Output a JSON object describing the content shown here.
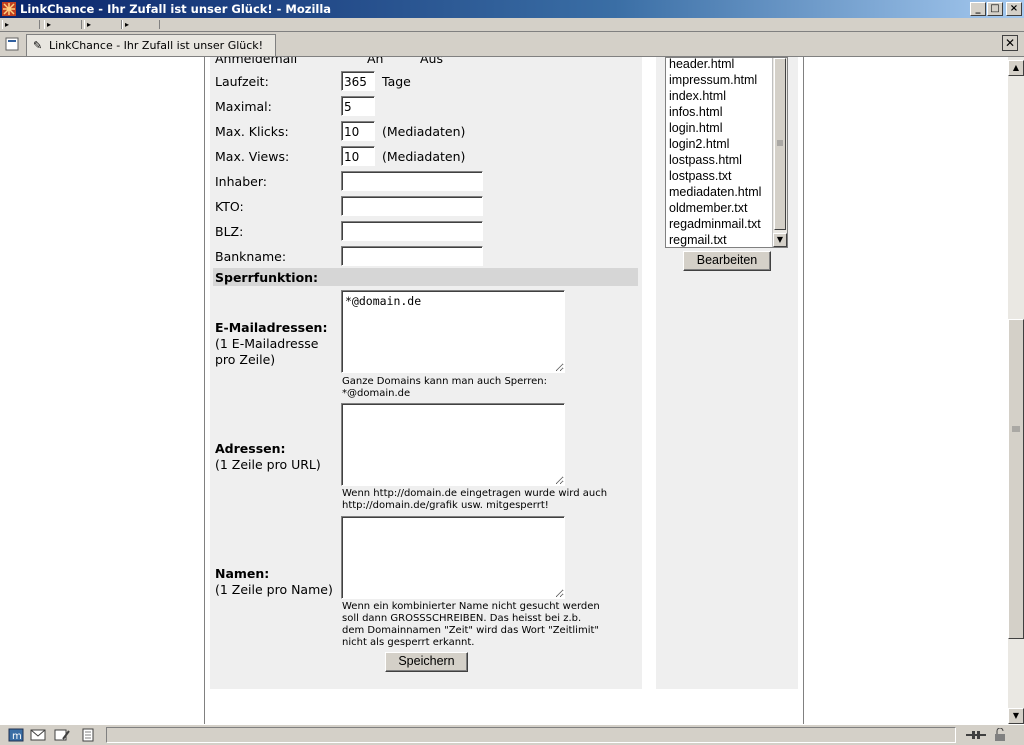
{
  "window": {
    "title": "LinkChance - Ihr Zufall ist unser Glück! - Mozilla",
    "buttons": {
      "minimize": "_",
      "maximize": "□",
      "close": "×"
    }
  },
  "tab": {
    "label": "LinkChance - Ihr Zufall ist unser Glück!"
  },
  "form": {
    "partial_label": "Anmeldemail",
    "partial_on": "An",
    "partial_off": "Aus",
    "rows": [
      {
        "label": "Laufzeit:",
        "value": "365",
        "suffix": "Tage"
      },
      {
        "label": "Maximal:",
        "value": "5",
        "suffix": ""
      },
      {
        "label": "Max. Klicks:",
        "value": "10",
        "suffix": "(Mediadaten)"
      },
      {
        "label": "Max. Views:",
        "value": "10",
        "suffix": "(Mediadaten)"
      },
      {
        "label": "Inhaber:",
        "value": "",
        "suffix": ""
      },
      {
        "label": "KTO:",
        "value": "",
        "suffix": ""
      },
      {
        "label": "BLZ:",
        "value": "",
        "suffix": ""
      },
      {
        "label": "Bankname:",
        "value": "",
        "suffix": ""
      }
    ],
    "section_title": "Sperrfunktion:",
    "email": {
      "label": "E-Mailadressen:",
      "sublabel1": "(1 E-Mailadresse",
      "sublabel2": "pro Zeile)",
      "value": "*@domain.de",
      "hint1": "Ganze Domains kann man auch Sperren:",
      "hint2": "*@domain.de"
    },
    "addresses": {
      "label": "Adressen:",
      "sublabel": "(1 Zeile pro URL)",
      "value": "",
      "hint1": "Wenn http://domain.de eingetragen wurde wird auch",
      "hint2": "http://domain.de/grafik usw. mitgesperrt!"
    },
    "names": {
      "label": "Namen:",
      "sublabel": "(1 Zeile pro Name)",
      "value": "",
      "hint1": "Wenn ein kombinierter Name nicht gesucht werden",
      "hint2": "soll dann GROSSSCHREIBEN. Das heisst bei z.b.",
      "hint3": "dem Domainnamen \"Zeit\" wird das Wort \"Zeitlimit\"",
      "hint4": "nicht als gesperrt erkannt."
    },
    "save_label": "Speichern"
  },
  "sidebar": {
    "files": [
      "header.html",
      "impressum.html",
      "index.html",
      "infos.html",
      "login.html",
      "login2.html",
      "lostpass.html",
      "lostpass.txt",
      "mediadaten.html",
      "oldmember.txt",
      "regadminmail.txt",
      "regmail.txt"
    ],
    "edit_label": "Bearbeiten"
  },
  "icons": {
    "app": "mozilla-icon",
    "status": [
      "navigator-icon",
      "mail-icon",
      "composer-icon",
      "addressbook-icon"
    ]
  }
}
